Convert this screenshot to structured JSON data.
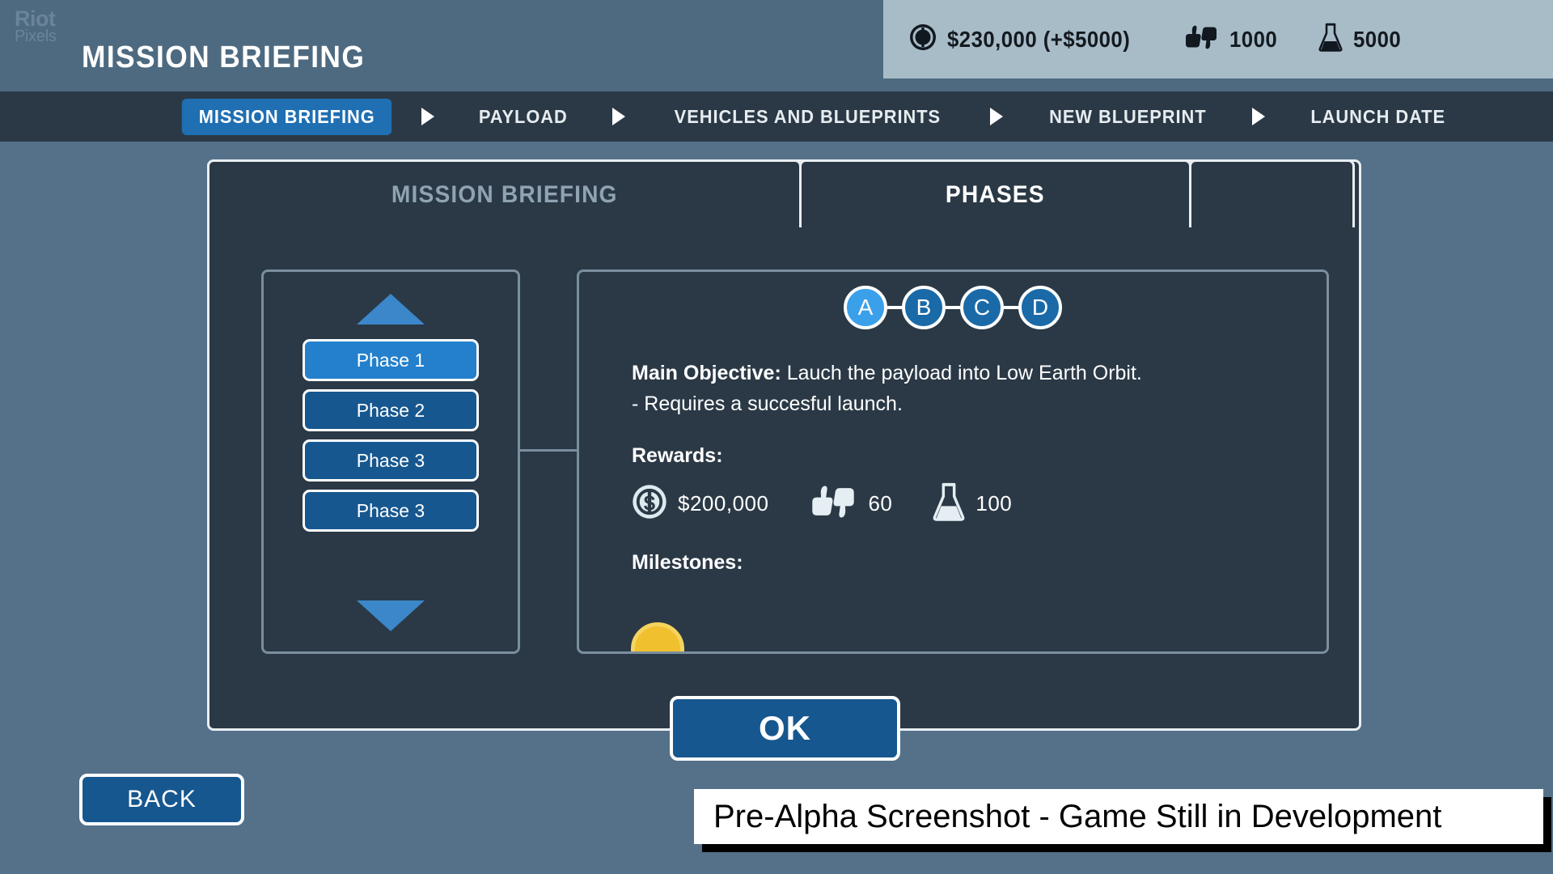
{
  "header": {
    "watermark_line1": "Riot",
    "watermark_line2": "Pixels",
    "title": "MISSION BRIEFING",
    "resources": [
      {
        "icon": "cash-icon",
        "value": "$230,000 (+$5000)"
      },
      {
        "icon": "reputation-icon",
        "value": "1000"
      },
      {
        "icon": "science-icon",
        "value": "5000"
      }
    ]
  },
  "breadcrumb": {
    "items": [
      {
        "label": "MISSION BRIEFING",
        "active": true
      },
      {
        "label": "PAYLOAD",
        "active": false
      },
      {
        "label": "VEHICLES AND BLUEPRINTS",
        "active": false
      },
      {
        "label": "NEW BLUEPRINT",
        "active": false
      },
      {
        "label": "LAUNCH DATE",
        "active": false
      }
    ]
  },
  "tabs": [
    {
      "label": "MISSION BRIEFING",
      "active": false
    },
    {
      "label": "PHASES",
      "active": true
    },
    {
      "label": "",
      "active": false
    }
  ],
  "phase_list": {
    "scroll_up_icon": "triangle-up-icon",
    "scroll_down_icon": "triangle-down-icon",
    "items": [
      {
        "label": "Phase 1",
        "selected": true
      },
      {
        "label": "Phase 2",
        "selected": false
      },
      {
        "label": "Phase 3",
        "selected": false
      },
      {
        "label": "Phase 3",
        "selected": false
      }
    ]
  },
  "detail": {
    "nodes": [
      {
        "label": "A",
        "active": true
      },
      {
        "label": "B",
        "active": false
      },
      {
        "label": "C",
        "active": false
      },
      {
        "label": "D",
        "active": false
      }
    ],
    "objective_label": "Main Objective:",
    "objective_text": " Lauch the payload into Low Earth Orbit.",
    "requirement_text": "- Requires a succesful launch.",
    "rewards_label": "Rewards:",
    "rewards": [
      {
        "icon": "cash-icon",
        "value": "$200,000"
      },
      {
        "icon": "reputation-icon",
        "value": "60"
      },
      {
        "icon": "science-icon",
        "value": "100"
      }
    ],
    "milestones_label": "Milestones:"
  },
  "buttons": {
    "ok": "OK",
    "back": "BACK"
  },
  "banner": {
    "text": "Pre-Alpha Screenshot - Game Still in Development"
  },
  "colors": {
    "background": "#55718a",
    "panel": "#2b3946",
    "accent_blue": "#1f6fb2",
    "active_blue": "#3ba0ea",
    "resource_bar": "#a8bcc8",
    "milestone_gold": "#f0c02f"
  }
}
